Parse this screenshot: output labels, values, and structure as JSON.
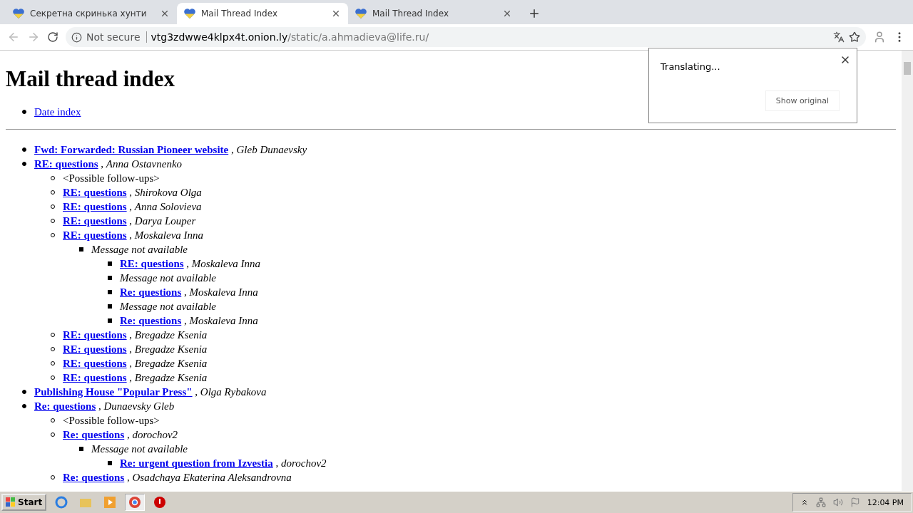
{
  "tabs": [
    {
      "title": "Секретна скринька хунти",
      "selected": false
    },
    {
      "title": "Mail Thread Index",
      "selected": true
    },
    {
      "title": "Mail Thread Index",
      "selected": false
    }
  ],
  "address_bar": {
    "security": "Not secure",
    "host": "vtg3zdwwe4klpx4t.onion.ly",
    "path": "/static/a.ahmadieva@life.ru/"
  },
  "page": {
    "heading": "Mail thread index",
    "nav": [
      "Date index"
    ],
    "threads": [
      {
        "kind": "link",
        "subject": "Fwd: Forwarded: Russian Pioneer website",
        "separator": ",",
        "author": "Gleb Dunaevsky"
      },
      {
        "kind": "link",
        "subject": "RE: questions",
        "separator": ",",
        "author": "Anna Ostavnenko",
        "children": [
          {
            "kind": "note",
            "text": "<Possible follow-ups>"
          },
          {
            "kind": "link",
            "subject": "RE: questions",
            "separator": ",",
            "author": "Shirokova Olga"
          },
          {
            "kind": "link",
            "subject": "RE: questions",
            "separator": ",",
            "author": "Anna Solovieva"
          },
          {
            "kind": "link",
            "subject": "RE: questions",
            "separator": ",",
            "author": "Darya Louper"
          },
          {
            "kind": "link",
            "subject": "RE: questions",
            "separator": ",",
            "author": "Moskaleva Inna",
            "children": [
              {
                "kind": "missing",
                "text": "Message not available",
                "children": [
                  {
                    "kind": "link",
                    "subject": "RE: questions",
                    "separator": ",",
                    "author": "Moskaleva Inna"
                  },
                  {
                    "kind": "missing",
                    "text": "Message not available"
                  },
                  {
                    "kind": "link",
                    "subject": "Re: questions",
                    "separator": ",",
                    "author": "Moskaleva Inna"
                  },
                  {
                    "kind": "missing",
                    "text": "Message not available"
                  },
                  {
                    "kind": "link",
                    "subject": "Re: questions",
                    "separator": ",",
                    "author": "Moskaleva Inna"
                  }
                ]
              }
            ]
          },
          {
            "kind": "link",
            "subject": "RE: questions",
            "separator": ",",
            "author": "Bregadze Ksenia"
          },
          {
            "kind": "link",
            "subject": "RE: questions",
            "separator": ",",
            "author": "Bregadze Ksenia"
          },
          {
            "kind": "link",
            "subject": "RE: questions",
            "separator": ",",
            "author": "Bregadze Ksenia"
          },
          {
            "kind": "link",
            "subject": "RE: questions",
            "separator": ",",
            "author": "Bregadze Ksenia"
          }
        ]
      },
      {
        "kind": "link",
        "subject": "Publishing House \"Popular Press\"",
        "separator": ",",
        "author": "Olga Rybakova"
      },
      {
        "kind": "link",
        "subject": "Re: questions",
        "separator": ",",
        "author": "Dunaevsky Gleb",
        "children": [
          {
            "kind": "note",
            "text": "<Possible follow-ups>"
          },
          {
            "kind": "link",
            "subject": "Re: questions",
            "separator": ",",
            "author": "dorochov2",
            "children": [
              {
                "kind": "missing",
                "text": "Message not available",
                "children": [
                  {
                    "kind": "link",
                    "subject": "Re: urgent question from Izvestia",
                    "separator": ",",
                    "author": "dorochov2"
                  }
                ]
              }
            ]
          },
          {
            "kind": "link",
            "subject": "Re: questions",
            "separator": ",",
            "author": "Osadchaya Ekaterina Aleksandrovna"
          }
        ]
      }
    ]
  },
  "translate_popup": {
    "status": "Translating...",
    "button": "Show original"
  },
  "taskbar": {
    "start": "Start",
    "clock": "12:04 PM"
  }
}
